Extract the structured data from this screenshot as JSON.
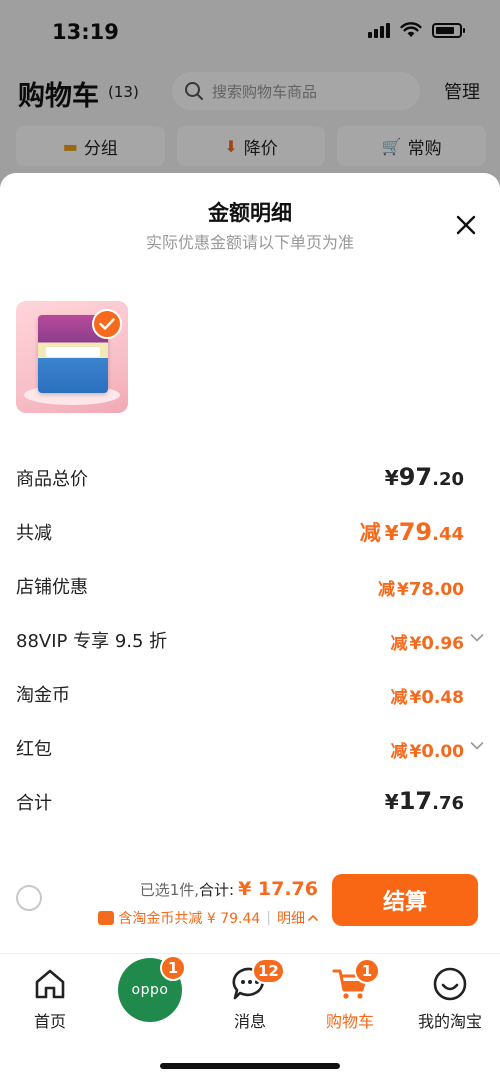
{
  "status_bar": {
    "time": "13:19"
  },
  "cart_header": {
    "title": "购物车",
    "count": "(13)",
    "search_placeholder": "搜索购物车商品",
    "manage_label": "管理"
  },
  "filters": [
    {
      "label": "分组",
      "icon": "folder-icon"
    },
    {
      "label": "降价",
      "icon": "price-drop-icon"
    },
    {
      "label": "常购",
      "icon": "cart-icon"
    }
  ],
  "sheet": {
    "title": "金额明细",
    "subtitle": "实际优惠金额请以下单页为准",
    "rows": [
      {
        "label": "商品总价",
        "prefix": "",
        "currency": "¥",
        "integer": "97",
        "decimal": ".20",
        "style": "normal"
      },
      {
        "label": "共减",
        "prefix": "减",
        "currency": "¥",
        "integer": "79",
        "decimal": ".44",
        "style": "orange"
      },
      {
        "label": "店铺优惠",
        "prefix": "减",
        "currency": "¥",
        "integer": "78",
        "decimal": ".00",
        "style": "orange"
      },
      {
        "label": "88VIP 专享 9.5 折",
        "prefix": "减",
        "currency": "¥",
        "integer": "0",
        "decimal": ".96",
        "style": "orange",
        "expandable": true
      },
      {
        "label": "淘金币",
        "prefix": "减",
        "currency": "¥",
        "integer": "0",
        "decimal": ".48",
        "style": "orange"
      },
      {
        "label": "红包",
        "prefix": "减",
        "currency": "¥",
        "integer": "0",
        "decimal": ".00",
        "style": "orange",
        "expandable": true
      },
      {
        "label": "合计",
        "prefix": "",
        "currency": "¥",
        "integer": "17",
        "decimal": ".76",
        "style": "normal"
      }
    ]
  },
  "checkout": {
    "selected_text": "已选1件,",
    "total_label": "合计:",
    "total_amount": "¥ 17.76",
    "coin_text": "含淘金币共减 ¥ 79.44",
    "detail_label": "明细",
    "pay_label": "结算"
  },
  "tabbar": {
    "tabs": [
      {
        "label": "首页",
        "icon": "home-icon"
      },
      {
        "label": "",
        "icon": "oppo-ball-icon",
        "badge": "1",
        "ball_text": "oppo"
      },
      {
        "label": "消息",
        "icon": "message-icon",
        "badge": "12"
      },
      {
        "label": "购物车",
        "icon": "cart-icon",
        "badge": "1",
        "active": true
      },
      {
        "label": "我的淘宝",
        "icon": "profile-icon"
      }
    ]
  },
  "colors": {
    "accent": "#f56a1c",
    "button": "#fa6714",
    "oppo_green": "#1f8a4c"
  }
}
